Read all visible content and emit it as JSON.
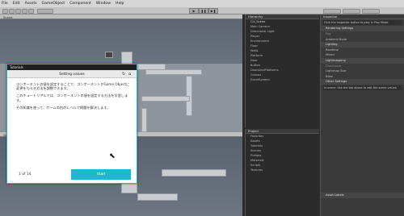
{
  "menu": [
    "File",
    "Edit",
    "Assets",
    "GameObject",
    "Component",
    "Window",
    "Help"
  ],
  "play_controls": [
    "▶",
    "❚❚",
    "▶❚"
  ],
  "panels": {
    "scene": "Scene",
    "game": "Game",
    "hierarchy": "Hierarchy",
    "project": "Project",
    "inspector": "Inspector"
  },
  "hierarchy_items": [
    "CLI_Scene",
    "Main Camera",
    "Directional Light",
    "Player",
    "Environment",
    "Floor",
    "Walls",
    "Platform",
    "Door",
    "Button",
    "DoorsAndPlatforms",
    "Canvas",
    "EventSystem"
  ],
  "project_items": [
    "Favorites",
    "Assets",
    "Tutorials",
    "Scenes",
    "Prefabs",
    "Materials",
    "Scripts",
    "Textures"
  ],
  "inspector": {
    "help_text": "Click the Inspector button to play in Play Mode.",
    "rows": [
      "Rendering Settings",
      "Fog",
      "Ambient Mode",
      "Lighting",
      "Realtime",
      "Mixed",
      "Lightmapping",
      "Directional",
      "Lightmap Size",
      "Bake",
      "Other Settings"
    ],
    "note": "In-scene: Use the tab above to edit the scene values.",
    "bottom": [
      "Asset Labels"
    ]
  },
  "tutorial": {
    "window_title": "Tutorials",
    "header_title": "Setting values",
    "back_icon": "refresh-icon",
    "home_icon": "home-icon",
    "paragraph1": "コンポーネントの値を設定することで、コンポーネントがGame Objectに変更を与える方法を調整できます。",
    "paragraph2": "このチュートリアルでは、コンポーネントの値を設定する方法を学習します。",
    "paragraph3": "その知識を使って、ゲームの別のレベルで問題を解決します。",
    "pager": "1 of 14",
    "start_label": "Start"
  }
}
